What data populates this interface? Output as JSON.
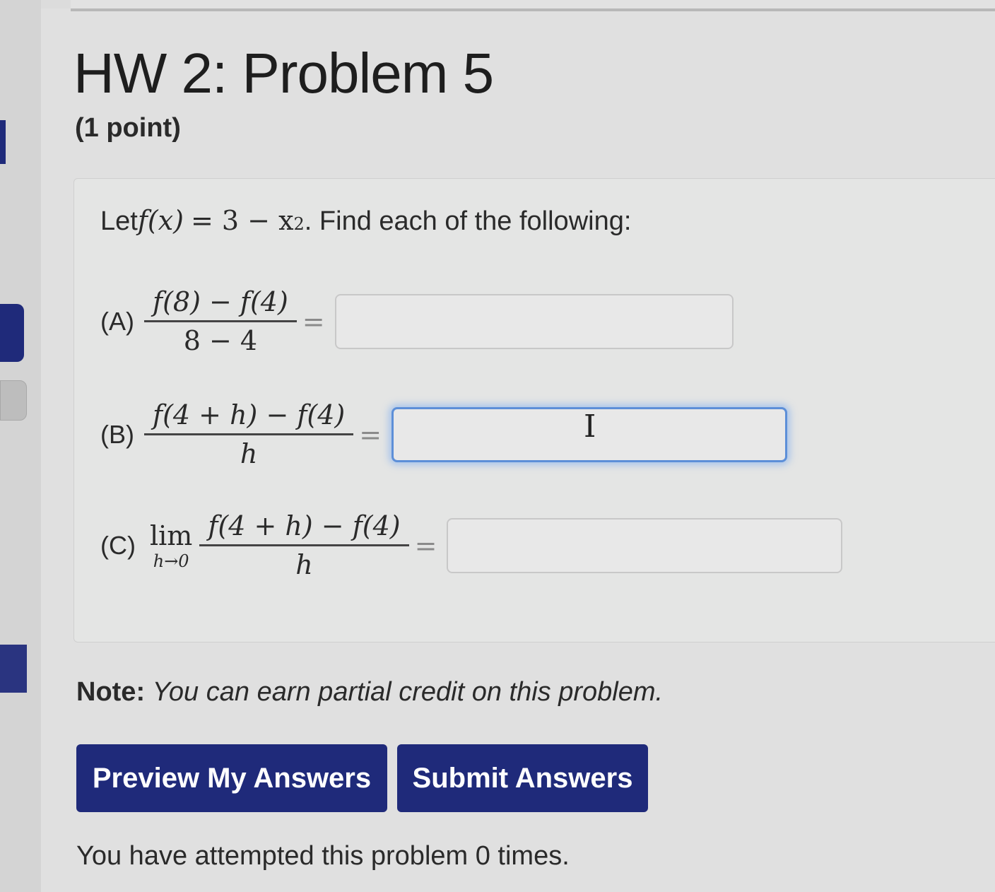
{
  "page": {
    "title": "HW 2: Problem 5",
    "points": "(1 point)"
  },
  "problem": {
    "statement_prefix": "Let ",
    "function_lhs": "f(x)",
    "function_rhs": "= 3 − x",
    "exponent": "2",
    "statement_suffix": ". Find each of the following:",
    "parts": [
      {
        "label": "(A)",
        "numerator": "f(8) − f(4)",
        "denominator": "8 − 4",
        "equals": "=",
        "value": ""
      },
      {
        "label": "(B)",
        "numerator": "f(4 + h) − f(4)",
        "denominator": "h",
        "equals": "=",
        "value": "",
        "focused": true
      },
      {
        "label": "(C)",
        "limit": "lim",
        "limit_sub": "h→0",
        "numerator": "f(4 + h) − f(4)",
        "denominator": "h",
        "equals": "=",
        "value": ""
      }
    ]
  },
  "note": {
    "label": "Note:",
    "text": "You can earn partial credit on this problem."
  },
  "buttons": {
    "preview": "Preview My Answers",
    "submit": "Submit Answers"
  },
  "attempts": "You have attempted this problem 0 times.",
  "colors": {
    "button_bg": "#1f2a7a",
    "focus_ring": "#5d8fd8"
  }
}
